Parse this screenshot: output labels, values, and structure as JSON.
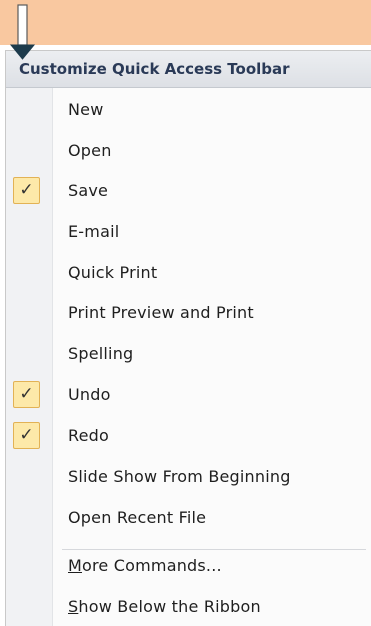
{
  "header": {
    "title": "Customize Quick Access Toolbar"
  },
  "items": [
    {
      "label": "New",
      "checked": false
    },
    {
      "label": "Open",
      "checked": false
    },
    {
      "label": "Save",
      "checked": true
    },
    {
      "label": "E-mail",
      "checked": false
    },
    {
      "label": "Quick Print",
      "checked": false
    },
    {
      "label": "Print Preview and Print",
      "checked": false
    },
    {
      "label": "Spelling",
      "checked": false
    },
    {
      "label": "Undo",
      "checked": true
    },
    {
      "label": "Redo",
      "checked": true
    },
    {
      "label": "Slide Show From Beginning",
      "checked": false
    },
    {
      "label": "Open Recent File",
      "checked": false
    }
  ],
  "more_commands": {
    "accel": "M",
    "rest": "ore Commands..."
  },
  "show_below": {
    "accel": "S",
    "rest": "how Below the Ribbon"
  },
  "check_glyph": "✓",
  "colors": {
    "top_band": "#f9c8a0",
    "header_text": "#2a3a57",
    "check_fill": "#fde9a9",
    "check_border": "#e2b255"
  },
  "icons": {
    "pointer": "down-arrow-icon",
    "check": "checkmark-icon"
  }
}
